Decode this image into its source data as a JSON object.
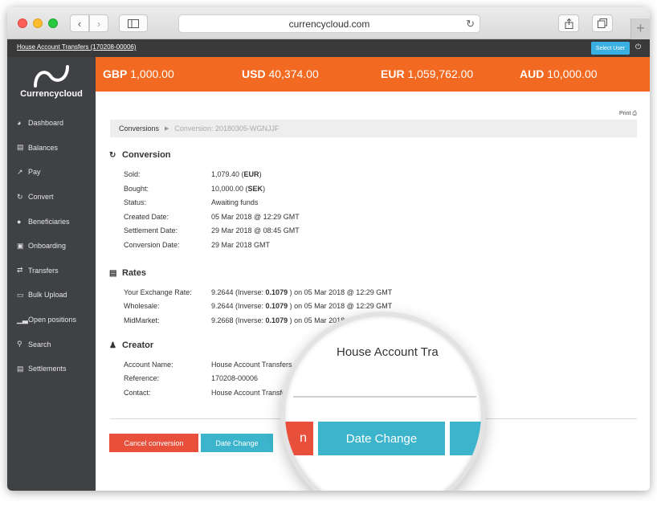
{
  "browser": {
    "address": "currencycloud.com"
  },
  "topbar": {
    "account_link": "House Account Transfers (170208-00006)",
    "select_user": "Select User"
  },
  "sidebar": {
    "logo_text": "Currencycloud",
    "items": [
      {
        "label": "Dashboard",
        "icon": "dashboard-icon"
      },
      {
        "label": "Balances",
        "icon": "balances-icon"
      },
      {
        "label": "Pay",
        "icon": "pay-icon"
      },
      {
        "label": "Convert",
        "icon": "convert-icon"
      },
      {
        "label": "Beneficiaries",
        "icon": "beneficiaries-icon"
      },
      {
        "label": "Onboarding",
        "icon": "onboarding-icon"
      },
      {
        "label": "Transfers",
        "icon": "transfers-icon"
      },
      {
        "label": "Bulk Upload",
        "icon": "bulk-upload-icon"
      },
      {
        "label": "Open positions",
        "icon": "open-positions-icon"
      },
      {
        "label": "Search",
        "icon": "search-icon"
      },
      {
        "label": "Settlements",
        "icon": "settlements-icon"
      }
    ]
  },
  "balances": [
    {
      "code": "GBP",
      "amount": "1,000.00"
    },
    {
      "code": "USD",
      "amount": "40,374.00"
    },
    {
      "code": "EUR",
      "amount": "1,059,762.00"
    },
    {
      "code": "AUD",
      "amount": "10,000.00"
    }
  ],
  "main": {
    "print": "Print",
    "breadcrumb": {
      "parent": "Conversions",
      "current": "Conversion: 20180305-WGNJJF"
    },
    "conversion": {
      "title": "Conversion",
      "rows": [
        {
          "label": "Sold:",
          "value": "1,079.40",
          "unit": "EUR"
        },
        {
          "label": "Bought:",
          "value": "10,000.00",
          "unit": "SEK"
        },
        {
          "label": "Status:",
          "value": "Awaiting funds"
        },
        {
          "label": "Created Date:",
          "value": "05 Mar 2018 @ 12:29 GMT"
        },
        {
          "label": "Settlement Date:",
          "value": "29 Mar 2018 @ 08:45 GMT"
        },
        {
          "label": "Conversion Date:",
          "value": "29 Mar 2018 GMT"
        }
      ]
    },
    "rates": {
      "title": "Rates",
      "rows": [
        {
          "label": "Your Exchange Rate:",
          "rate": "9.2644",
          "inverse": "0.1079",
          "suffix": "on 05 Mar 2018 @ 12:29 GMT"
        },
        {
          "label": "Wholesale:",
          "rate": "9.2644",
          "inverse": "0.1079",
          "suffix": "on 05 Mar 2018 @ 12:29 GMT"
        },
        {
          "label": "MidMarket:",
          "rate": "9.2668",
          "inverse": "0.1079",
          "suffix": "on 05 Mar 2018 @ 12:29 GMT"
        }
      ]
    },
    "creator": {
      "title": "Creator",
      "rows": [
        {
          "label": "Account Name:",
          "value": "House Account Transfers"
        },
        {
          "label": "Reference:",
          "value": "170208-00006"
        },
        {
          "label": "Contact:",
          "value": "House Account Transfers"
        }
      ]
    },
    "buttons": {
      "cancel": "Cancel conversion",
      "date_change": "Date Change"
    }
  },
  "magnifier": {
    "account": "House Account Tra",
    "date_change": "Date Change",
    "red_fragment": "n"
  }
}
